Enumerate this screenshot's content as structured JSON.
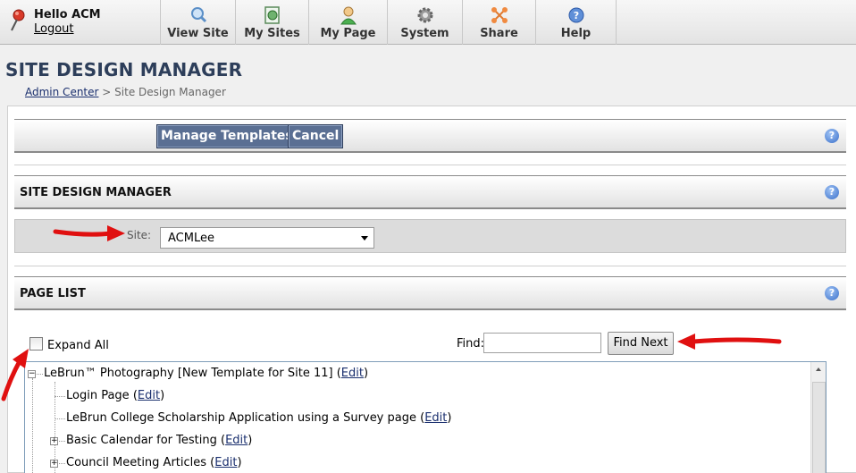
{
  "header": {
    "greeting": "Hello ACM",
    "logout_label": "Logout",
    "nav": [
      {
        "label": "View Site",
        "icon": "magnifier-icon"
      },
      {
        "label": "My Sites",
        "icon": "globe-document-icon"
      },
      {
        "label": "My Page",
        "icon": "user-icon"
      },
      {
        "label": "System",
        "icon": "gear-icon"
      },
      {
        "label": "Share",
        "icon": "share-icon"
      },
      {
        "label": "Help",
        "icon": "help-icon"
      }
    ]
  },
  "page": {
    "title": "SITE DESIGN MANAGER",
    "breadcrumb_link": "Admin Center",
    "breadcrumb_sep": ">",
    "breadcrumb_current": "Site Design Manager"
  },
  "toolbar": {
    "manage_templates_label": "Manage Templates",
    "cancel_label": "Cancel"
  },
  "site_section": {
    "title": "SITE DESIGN MANAGER",
    "site_label": "Site:",
    "site_value": "ACMLee"
  },
  "page_list": {
    "title": "PAGE LIST",
    "expand_all_label": "Expand All",
    "find_label": "Find:",
    "find_value": "",
    "find_next_label": "Find Next",
    "edit_label": "Edit",
    "nodes": [
      {
        "text": "LeBrun™ Photography [New Template for Site 11]",
        "toggle": "−"
      },
      {
        "text": "Login Page",
        "toggle": ""
      },
      {
        "text": "LeBrun College Scholarship Application using a Survey page",
        "toggle": ""
      },
      {
        "text": "Basic Calendar for Testing",
        "toggle": "+"
      },
      {
        "text": "Council Meeting Articles",
        "toggle": "+"
      }
    ]
  },
  "colors": {
    "title": "#2d3e5a",
    "button": "#5a6f93",
    "link": "#1a2f6e",
    "annotation_arrow": "#e01010"
  }
}
